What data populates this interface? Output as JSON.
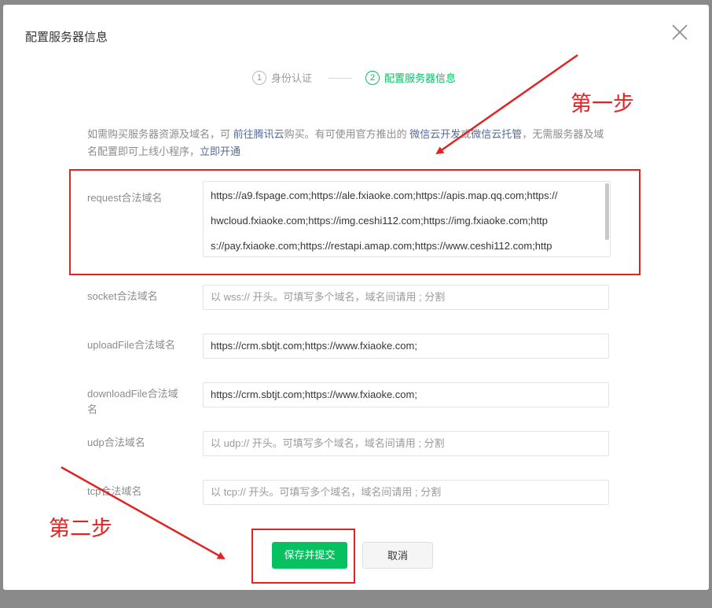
{
  "dialog": {
    "title": "配置服务器信息",
    "close_icon": "close-icon"
  },
  "steps": [
    {
      "number": "1",
      "label": "身份认证",
      "active": false
    },
    {
      "number": "2",
      "label": "配置服务器信息",
      "active": true
    }
  ],
  "notice": {
    "text1": "如需购买服务器资源及域名，可 ",
    "link1": "前往腾讯云",
    "text2": "购买。有可使用官方推出的 ",
    "link2": "微信云开发",
    "text3": "或",
    "link3": "微信云托管",
    "text4": "，无需服务器及域名配置即可上线小程序，",
    "link4": "立即开通"
  },
  "form": {
    "request": {
      "label": "request合法域名",
      "lines": [
        "https://a9.fspage.com;https://ale.fxiaoke.com;https://apis.map.qq.com;https://",
        "hwcloud.fxiaoke.com;https://img.ceshi112.com;https://img.fxiaoke.com;http",
        "s://pay.fxiaoke.com;https://restapi.amap.com;https://www.ceshi112.com;http"
      ]
    },
    "socket": {
      "label": "socket合法域名",
      "value": "",
      "placeholder": "以 wss:// 开头。可填写多个域名，域名间请用 ; 分割"
    },
    "uploadFile": {
      "label": "uploadFile合法域名",
      "value": "https://crm.sbtjt.com;https://www.fxiaoke.com;"
    },
    "downloadFile": {
      "label": "downloadFile合法域名",
      "value": "https://crm.sbtjt.com;https://www.fxiaoke.com;"
    },
    "udp": {
      "label": "udp合法域名",
      "value": "",
      "placeholder": "以 udp:// 开头。可填写多个域名，域名间请用 ; 分割"
    },
    "tcp": {
      "label": "tcp合法域名",
      "value": "",
      "placeholder": "以 tcp:// 开头。可填写多个域名，域名间请用 ; 分割"
    }
  },
  "buttons": {
    "submit": "保存并提交",
    "cancel": "取消"
  },
  "annotations": {
    "step1": "第一步",
    "step2": "第二步",
    "color": "#e02424"
  },
  "colors": {
    "accent": "#07c160",
    "link": "#576b95"
  }
}
